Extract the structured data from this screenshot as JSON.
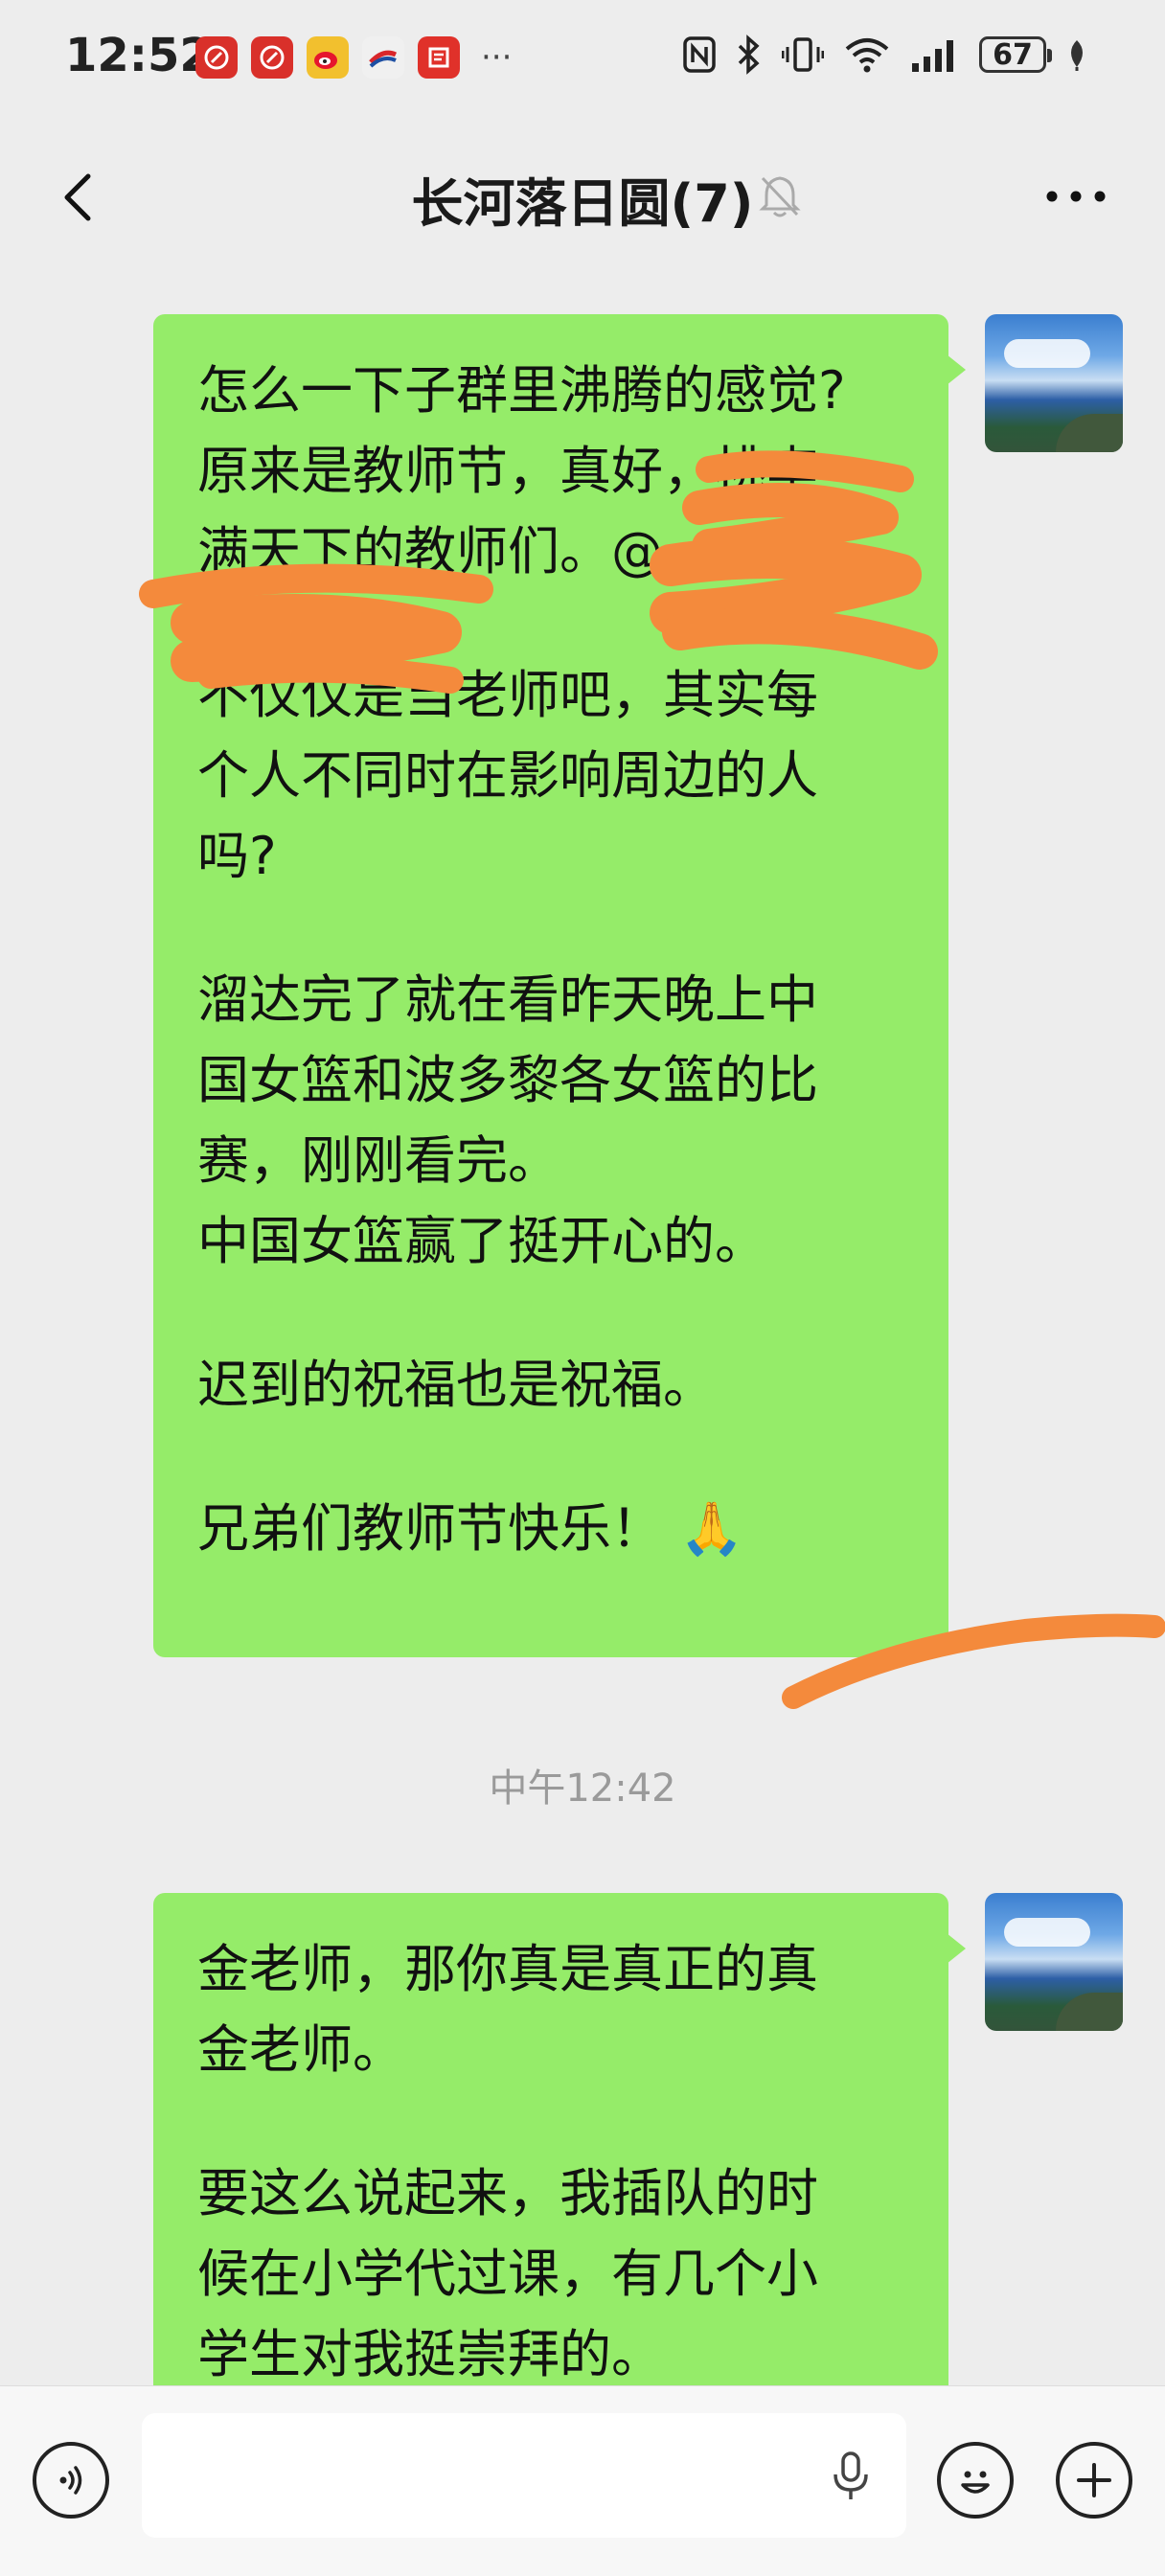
{
  "status_bar": {
    "time": "12:52",
    "battery": "67",
    "app_icons": [
      {
        "name": "app-icon-red-1",
        "color": "#d9302a"
      },
      {
        "name": "app-icon-red-2",
        "color": "#d9302a"
      },
      {
        "name": "weibo-icon",
        "color": "#f2a11e"
      },
      {
        "name": "app-icon-flag",
        "color": "#e5e5e5"
      },
      {
        "name": "app-icon-news",
        "color": "#e0312a"
      }
    ],
    "more_indicator": "···"
  },
  "header": {
    "title": "长河落日圆(7)"
  },
  "messages": [
    {
      "paragraphs": [
        [
          "怎么一下子群里沸腾的感觉?",
          "原来是教师节，真好，桃李",
          "满天下的教师们。@",
          ""
        ],
        [
          "不仅仅是当老师吧，其实每",
          "个人不同时在影响周边的人",
          "吗?"
        ],
        [
          "溜达完了就在看昨天晚上中",
          "国女篮和波多黎各女篮的比",
          "赛，刚刚看完。",
          "中国女篮赢了挺开心的。"
        ],
        [
          "迟到的祝福也是祝福。"
        ],
        [
          "兄弟们教师节快乐！ 🙏"
        ]
      ]
    },
    {
      "paragraphs": [
        [
          "金老师，那你真是真正的真",
          "金老师。"
        ],
        [
          "要这么说起来，我插队的时",
          "候在小学代过课，有几个小",
          "学生对我挺崇拜的。"
        ]
      ]
    }
  ],
  "timestamp": "中午12:42",
  "colors": {
    "bubble": "#95ec69",
    "background": "#ededed",
    "scribble": "#f48a3c"
  }
}
